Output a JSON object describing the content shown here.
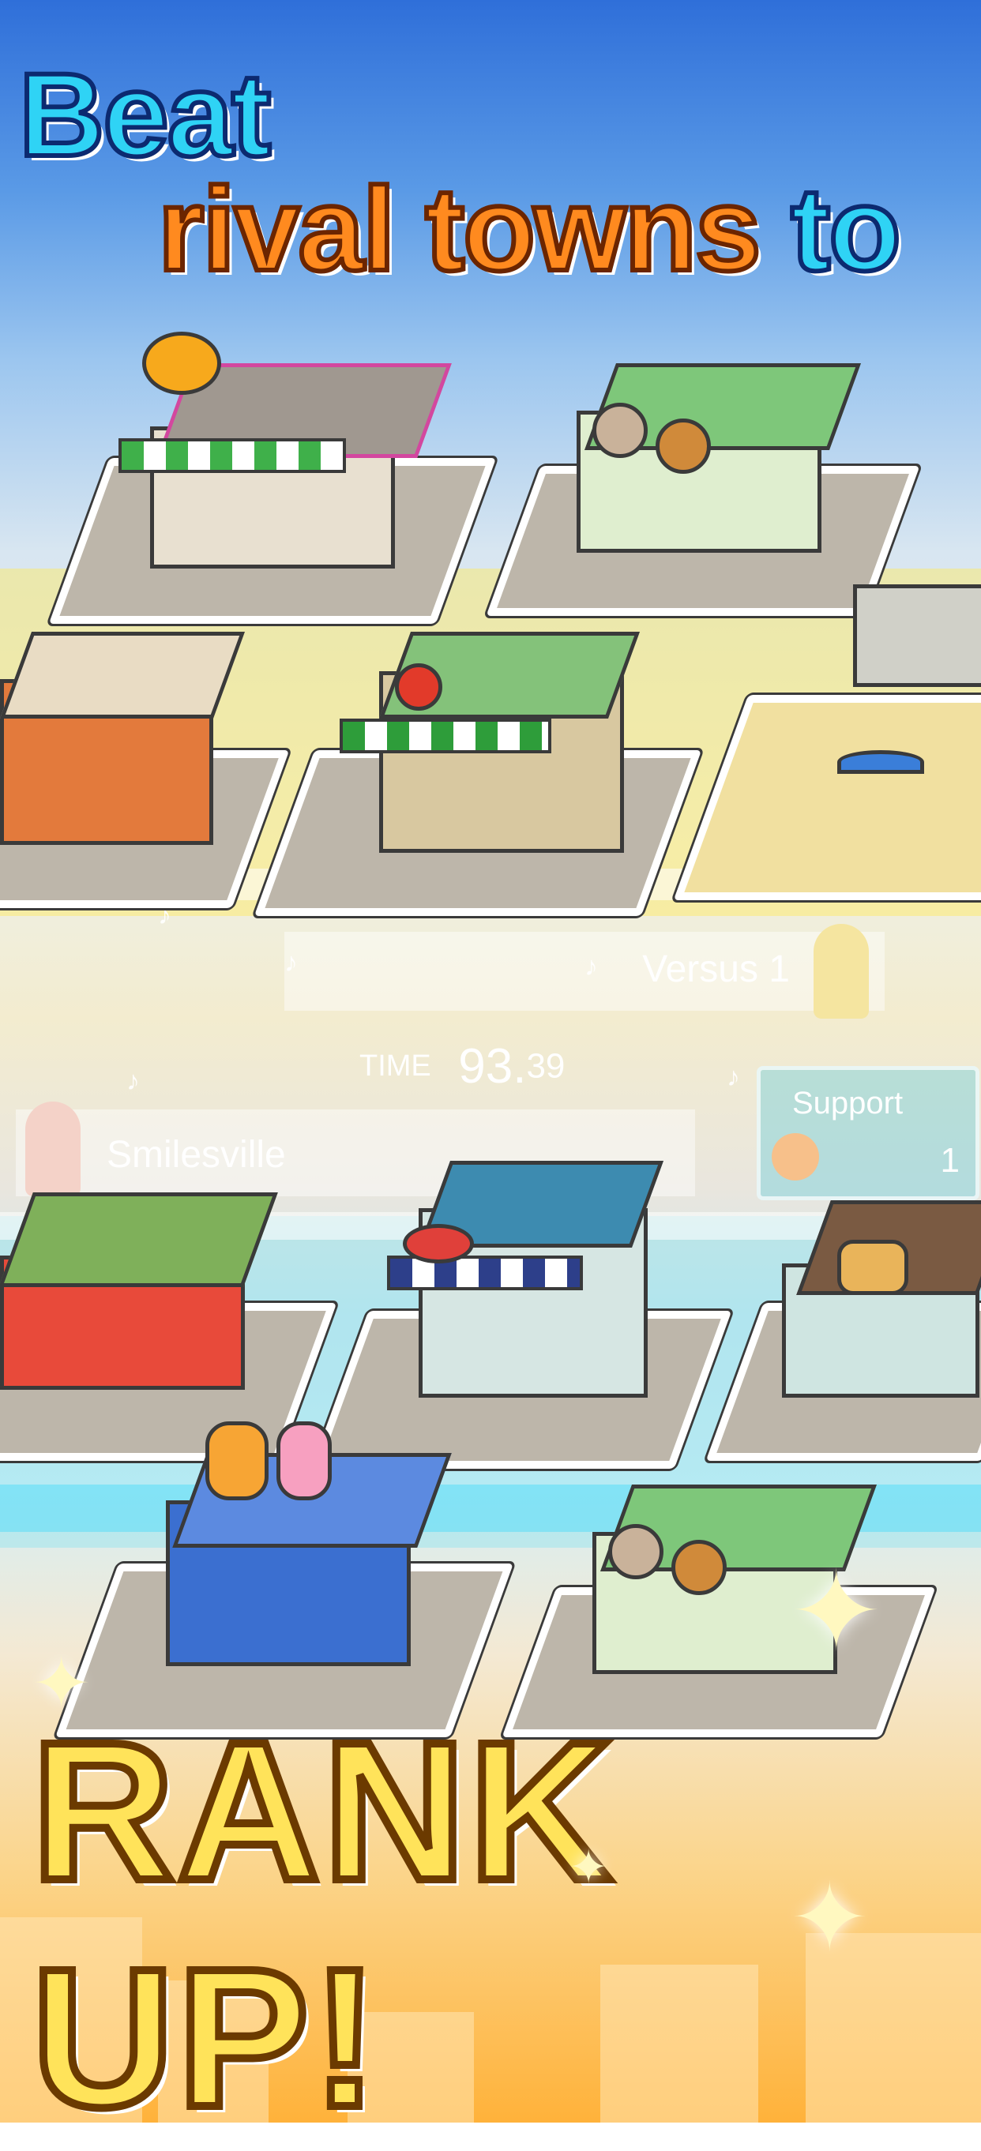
{
  "headline": {
    "line1": "Beat",
    "line2_part1": "rival towns",
    "line2_part2": "to",
    "tagline": "RANK UP!"
  },
  "game_ui": {
    "versus_label": "Versus 1",
    "time_label": "TIME",
    "time_value_int": "93.",
    "time_value_frac": "39",
    "support_label": "Support",
    "support_count": "1",
    "rival_town_name": "Smilesville"
  },
  "colors": {
    "headline_cyan": "#2fd3f5",
    "headline_orange": "#ff8a1f",
    "rank_up_yellow": "#ffe35a",
    "sky_top": "#2f6fd9",
    "bottom_orange": "#ffb23a"
  },
  "icons": [
    "music-note-icon",
    "sparkle-icon",
    "food-bowl-icon"
  ]
}
